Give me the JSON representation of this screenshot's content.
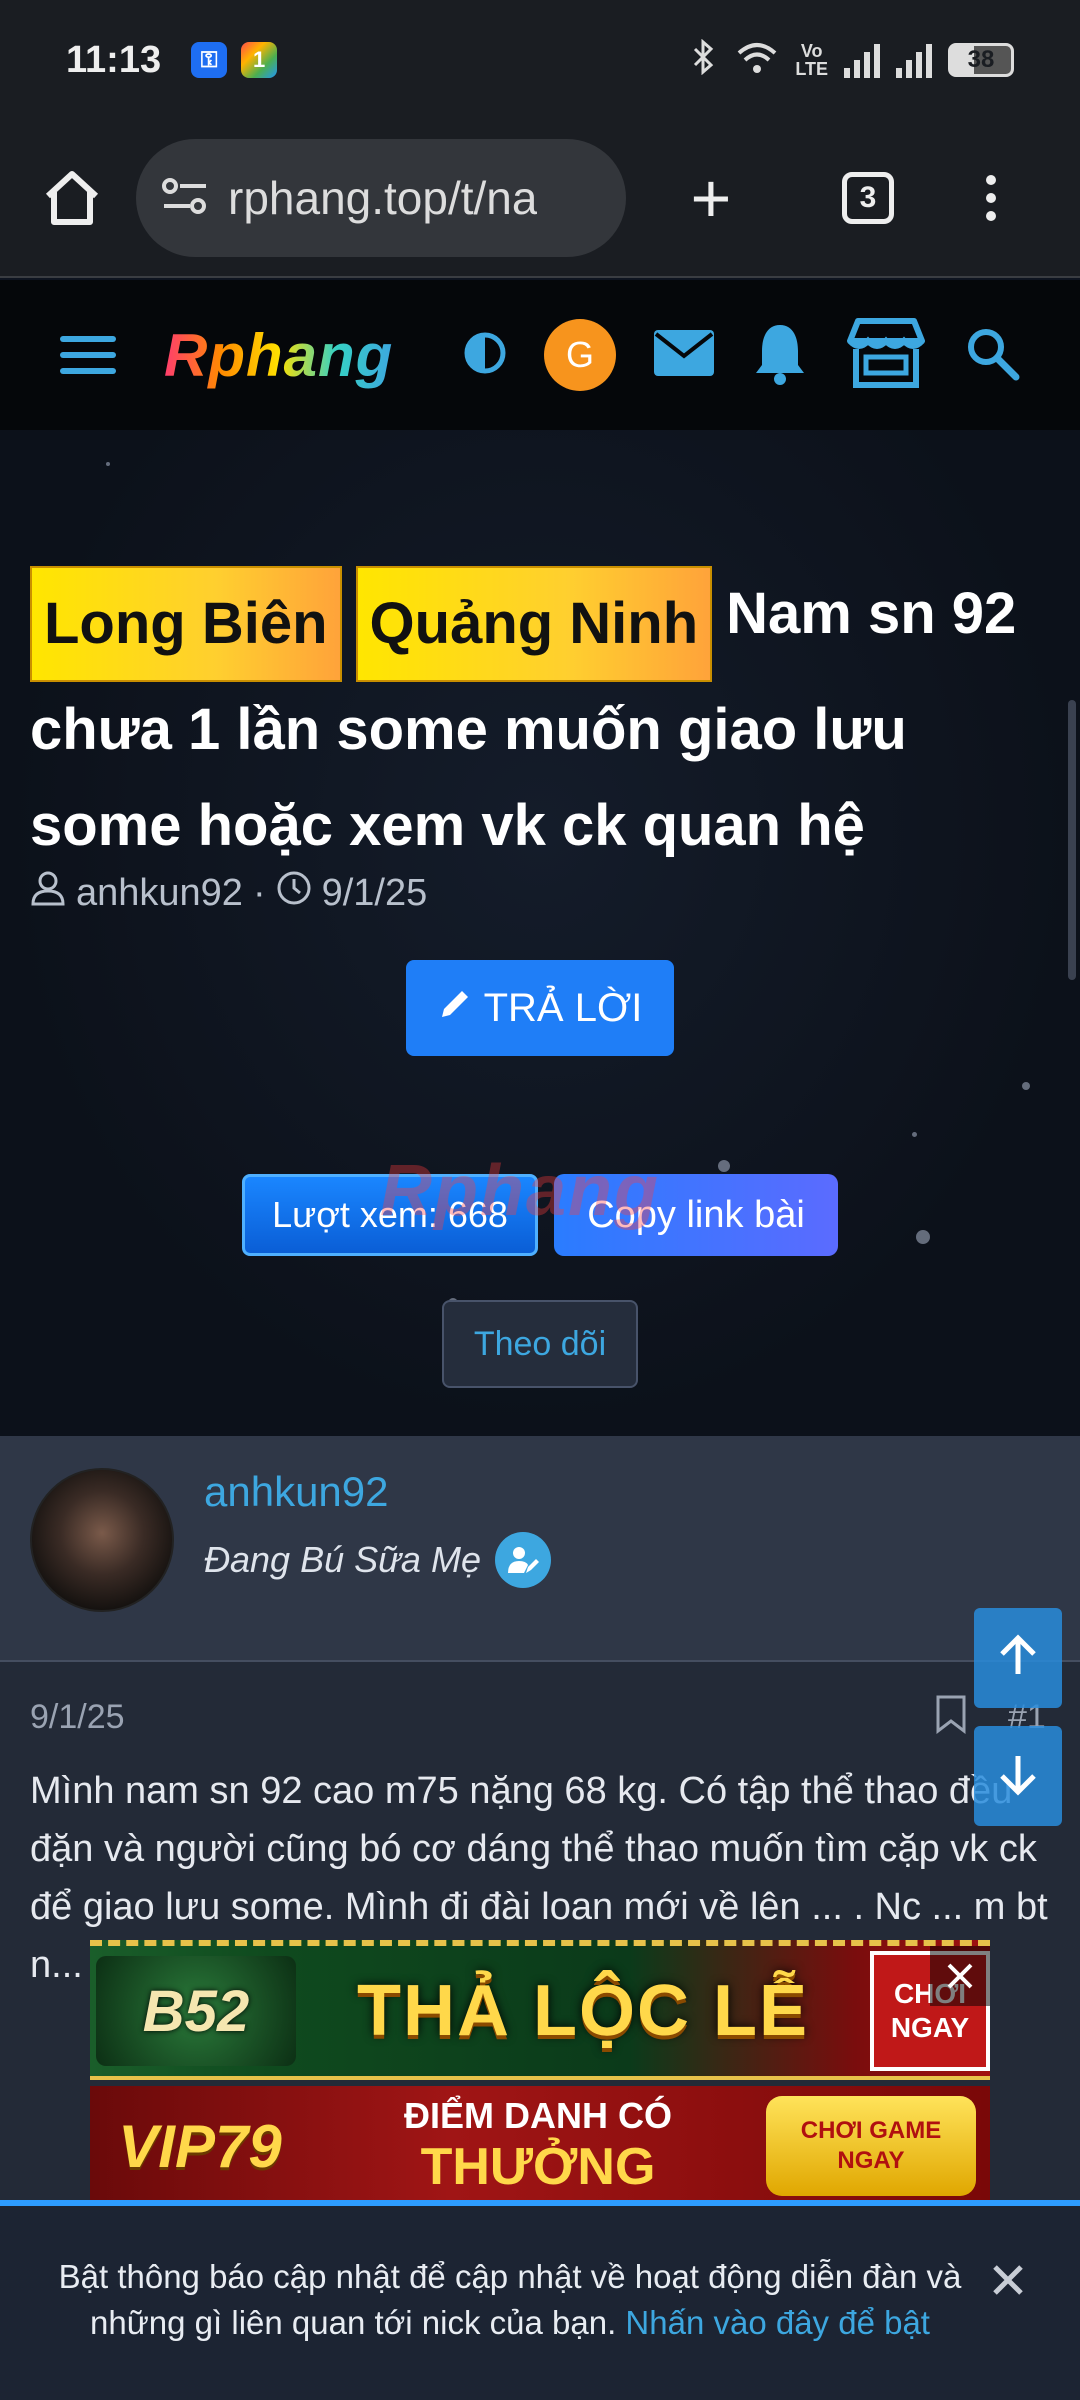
{
  "status_bar": {
    "time": "11:13",
    "battery": "38",
    "volte_line1": "Vo",
    "volte_line2": "LTE"
  },
  "browser": {
    "url": "rphang.top/t/na",
    "tab_count": "3"
  },
  "site": {
    "logo_text": "Rphang",
    "avatar_letter": "G"
  },
  "thread": {
    "prefix_1": "Long Biên",
    "prefix_2": "Quảng Ninh",
    "title": "Nam sn 92 chưa 1 lần some muốn giao lưu some hoặc xem vk ck quan hệ",
    "author": "anhkun92",
    "date": "9/1/25",
    "reply_label": "TRẢ LỜI",
    "views_label": "Lượt xem: 668",
    "copy_label": "Copy link bài",
    "follow_label": "Theo dõi",
    "watermark": "Rphang"
  },
  "post": {
    "username": "anhkun92",
    "user_title": "Đang Bú Sữa Mẹ",
    "date": "9/1/25",
    "number": "#1",
    "text": "Mình nam sn 92 cao m75 nặng 68 kg. Có tập thể thao đều đặn và người cũng bó cơ dáng thể thao muốn tìm cặp vk ck để giao lưu some. Mình đi đài loan mới về lên ... . Nc ... m bt n... hơn tuổ..."
  },
  "ads": {
    "ad1_brand": "B52",
    "ad1_headline": "THẢ LỘC LỄ",
    "ad1_cta": "CHƠI NGAY",
    "ad2_brand": "VIP79",
    "ad2_line1": "ĐIỂM DANH CÓ",
    "ad2_line2": "THƯỞNG",
    "ad2_cta": "CHƠI GAME NGAY"
  },
  "notification": {
    "message": "Bật thông báo cập nhật để cập nhật về hoạt động diễn đàn và những gì liên quan tới nick của bạn.",
    "link": "Nhấn vào đây để bật"
  },
  "colors": {
    "accent": "#3da7e0",
    "button_blue": "#1f7ef7",
    "prefix_yellow": "#ffe600",
    "avatar_orange": "#f7941d"
  }
}
